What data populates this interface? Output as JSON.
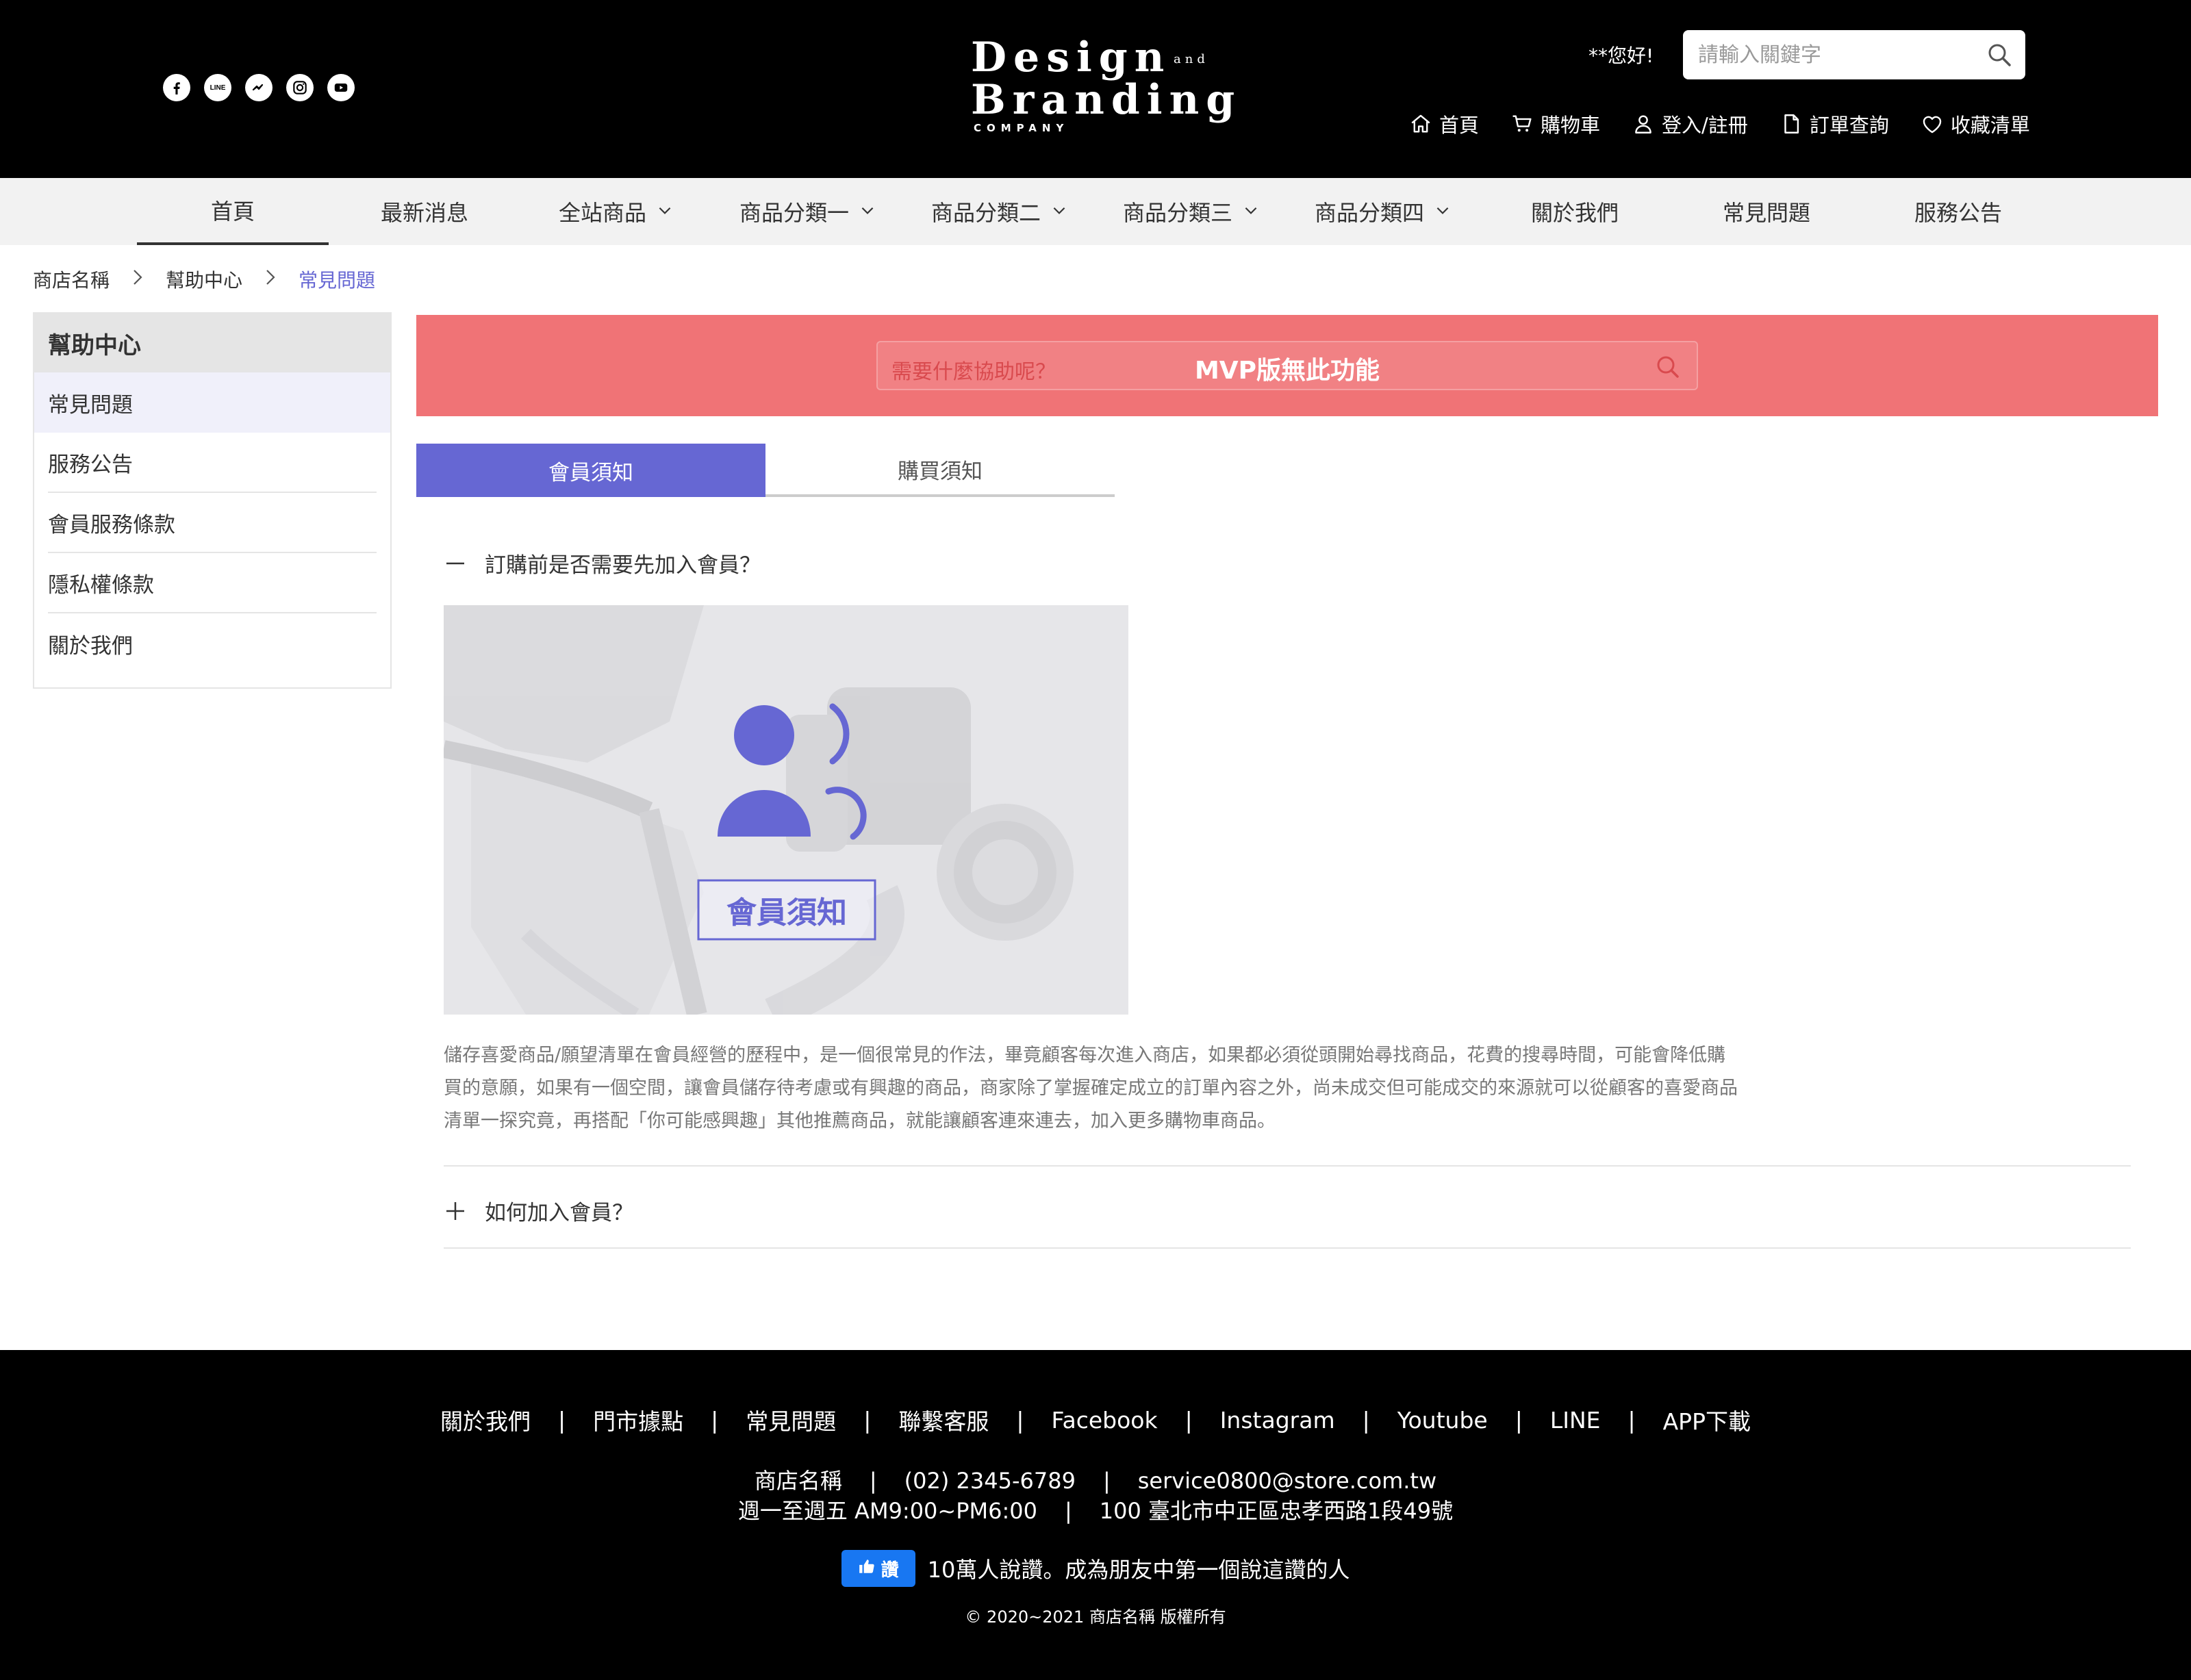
{
  "header": {
    "socials": [
      {
        "icon": "facebook-icon"
      },
      {
        "icon": "line-icon",
        "label": "LINE"
      },
      {
        "icon": "messenger-icon"
      },
      {
        "icon": "instagram-icon"
      },
      {
        "icon": "youtube-icon"
      }
    ],
    "logo": {
      "line1": "Design",
      "and": "and",
      "line2": "Branding",
      "company": "COMPANY"
    },
    "greeting": "**您好!",
    "search": {
      "placeholder": "請輸入關鍵字"
    },
    "top_links": [
      {
        "icon": "home-icon",
        "label": "首頁"
      },
      {
        "icon": "cart-icon",
        "label": "購物車"
      },
      {
        "icon": "user-icon",
        "label": "登入/註冊"
      },
      {
        "icon": "document-icon",
        "label": "訂單查詢"
      },
      {
        "icon": "heart-icon",
        "label": "收藏清單"
      }
    ]
  },
  "main_nav": [
    {
      "label": "首頁",
      "active": true
    },
    {
      "label": "最新消息"
    },
    {
      "label": "全站商品",
      "dropdown": true
    },
    {
      "label": "商品分類一",
      "dropdown": true
    },
    {
      "label": "商品分類二",
      "dropdown": true
    },
    {
      "label": "商品分類三",
      "dropdown": true
    },
    {
      "label": "商品分類四",
      "dropdown": true
    },
    {
      "label": "關於我們"
    },
    {
      "label": "常見問題"
    },
    {
      "label": "服務公告"
    }
  ],
  "breadcrumb": [
    "商店名稱",
    "幫助中心",
    "常見問題"
  ],
  "sidebar": {
    "title": "幫助中心",
    "items": [
      "常見問題",
      "服務公告",
      "會員服務條款",
      "隱私權條款",
      "關於我們"
    ]
  },
  "faq_search": {
    "placeholder": "需要什麼協助呢？",
    "notice": "MVP版無此功能"
  },
  "tabs": [
    {
      "label": "會員須知",
      "active": true
    },
    {
      "label": "購買須知"
    }
  ],
  "faq": {
    "q1": "訂購前是否需要先加入會員？",
    "image_caption": "會員須知",
    "a1": [
      "儲存喜愛商品/願望清單在會員經營的歷程中，是一個很常見的作法，畢竟顧客每次進入商店，如果都必須從頭開始尋找商品，花費的搜尋時間，可能會降低購",
      "買的意願，如果有一個空間，讓會員儲存待考慮或有興趣的商品，商家除了掌握確定成立的訂單內容之外，尚未成交但可能成交的來源就可以從顧客的喜愛商品",
      "清單一探究竟，再搭配「你可能感興趣」其他推薦商品，就能讓顧客連來連去，加入更多購物車商品。"
    ],
    "q2": "如何加入會員？"
  },
  "footer": {
    "links": [
      "關於我們",
      "門市據點",
      "常見問題",
      "聯繫客服",
      "Facebook",
      "Instagram",
      "Youtube",
      "LINE",
      "APP下載"
    ],
    "store_name": "商店名稱",
    "phone": "(02) 2345-6789",
    "email": "service0800@store.com.tw",
    "hours": "週一至週五 AM9:00~PM6:00",
    "address": "100 臺北市中正區忠孝西路1段49號",
    "fb_like": "讚",
    "fb_text": "10萬人說讚。成為朋友中第一個說這讚的人",
    "copyright": "© 2020~2021  商店名稱 版權所有"
  },
  "colors": {
    "accent": "#6667d3",
    "banner": "#f07376",
    "header_bg": "#000000",
    "nav_bg": "#f2f2f2",
    "fb_blue": "#1877f2"
  }
}
